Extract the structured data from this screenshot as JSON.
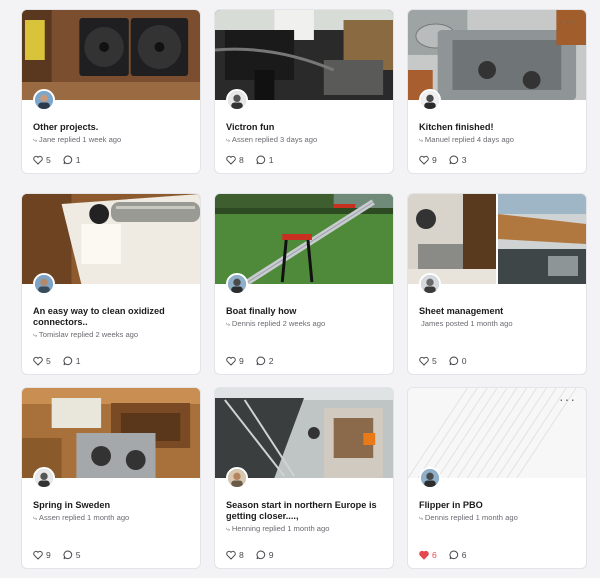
{
  "cards": [
    {
      "title": "Other projects.",
      "meta_arrow": "⤷",
      "meta": "Jane replied 1 week ago",
      "likes": "5",
      "replies": "1",
      "liked": false,
      "menu": ""
    },
    {
      "title": "Victron fun",
      "meta_arrow": "⤷",
      "meta": "Assen replied 3 days ago",
      "likes": "8",
      "replies": "1",
      "liked": false,
      "menu": ""
    },
    {
      "title": "Kitchen finished!",
      "meta_arrow": "⤷",
      "meta": "Manuel replied 4 days ago",
      "likes": "9",
      "replies": "3",
      "liked": false,
      "menu": "···"
    },
    {
      "title": "An easy way to clean oxidized connectors..",
      "meta_arrow": "⤷",
      "meta": "Tomislav replied 2 weeks ago",
      "likes": "5",
      "replies": "1",
      "liked": false,
      "menu": ""
    },
    {
      "title": "Boat finally how",
      "meta_arrow": "⤷",
      "meta": "Dennis replied 2 weeks ago",
      "likes": "9",
      "replies": "2",
      "liked": false,
      "menu": ""
    },
    {
      "title": "Sheet management",
      "meta_arrow": "",
      "meta": "James posted 1 month ago",
      "likes": "5",
      "replies": "0",
      "liked": false,
      "menu": ""
    },
    {
      "title": "Spring in Sweden",
      "meta_arrow": "⤷",
      "meta": "Assen replied 1 month ago",
      "likes": "9",
      "replies": "5",
      "liked": false,
      "menu": ""
    },
    {
      "title": "Season start in northern Europe is getting closer....,",
      "meta_arrow": "⤷",
      "meta": "Henning replied 1 month ago",
      "likes": "8",
      "replies": "9",
      "liked": false,
      "menu": ""
    },
    {
      "title": "Flipper in PBO",
      "meta_arrow": "⤷",
      "meta": "Dennis replied 1 month ago",
      "likes": "6",
      "replies": "6",
      "liked": true,
      "menu": "···"
    }
  ],
  "icons": {
    "like": "heart-icon",
    "reply": "comment-icon",
    "more": "more-dots-icon"
  },
  "colors": {
    "liked_heart": "#e5484d",
    "text_primary": "#1c1c1e",
    "text_secondary": "#6b6b72"
  }
}
